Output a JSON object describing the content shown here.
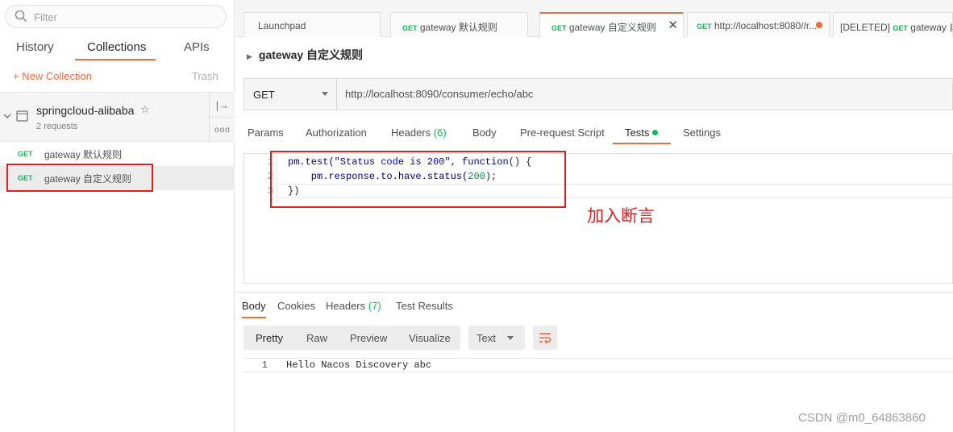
{
  "sidebar": {
    "filter_placeholder": "Filter",
    "tabs": [
      {
        "label": "History"
      },
      {
        "label": "Collections"
      },
      {
        "label": "APIs"
      }
    ],
    "new_collection": "+ New Collection",
    "trash": "Trash",
    "collection": {
      "name": "springcloud-alibaba",
      "star": "☆",
      "requests_count": "2 requests",
      "share_glyph": "|→",
      "more_glyph": "ooo"
    },
    "requests": [
      {
        "method": "GET",
        "name": "gateway 默认规则"
      },
      {
        "method": "GET",
        "name": "gateway 自定义规则"
      }
    ]
  },
  "tabs": [
    {
      "label": "Launchpad"
    },
    {
      "method": "GET",
      "label": "gateway 默认规则"
    },
    {
      "method": "GET",
      "label": "gateway 自定义规则",
      "close": "✕"
    },
    {
      "method": "GET",
      "label": "http://localhost:8080//r..."
    },
    {
      "prefix": "[DELETED]",
      "method": "GET",
      "label": "gateway 自..."
    }
  ],
  "request": {
    "title": "gateway 自定义规则",
    "method": "GET",
    "url": "http://localhost:8090/consumer/echo/abc"
  },
  "subtabs": {
    "params": "Params",
    "authorization": "Authorization",
    "headers": "Headers",
    "headers_count": "(6)",
    "body": "Body",
    "prerequest": "Pre-request Script",
    "tests": "Tests",
    "settings": "Settings"
  },
  "code": {
    "lines": [
      {
        "no": "1"
      },
      {
        "no": "2"
      },
      {
        "no": "3"
      }
    ],
    "l1_a": "pm.test(",
    "l1_str": "\"Status code is 200\"",
    "l1_b": ", ",
    "l1_kw": "function",
    "l1_c": "() {",
    "l2_a": "    pm.response.to.have.status(",
    "l2_num": "200",
    "l2_b": ");",
    "l3": "})"
  },
  "annotation": "加入断言",
  "response": {
    "tabs": {
      "body": "Body",
      "cookies": "Cookies",
      "headers": "Headers",
      "headers_count": "(7)",
      "test_results": "Test Results"
    },
    "formats": [
      "Pretty",
      "Raw",
      "Preview",
      "Visualize"
    ],
    "type": "Text",
    "body_line_no": "1",
    "body_text": "Hello Nacos Discovery abc"
  },
  "watermark": "CSDN @m0_64863860",
  "colors": {
    "accent": "#f26b3a",
    "method_get": "#0cbb52",
    "annotation_red": "#e02020"
  }
}
